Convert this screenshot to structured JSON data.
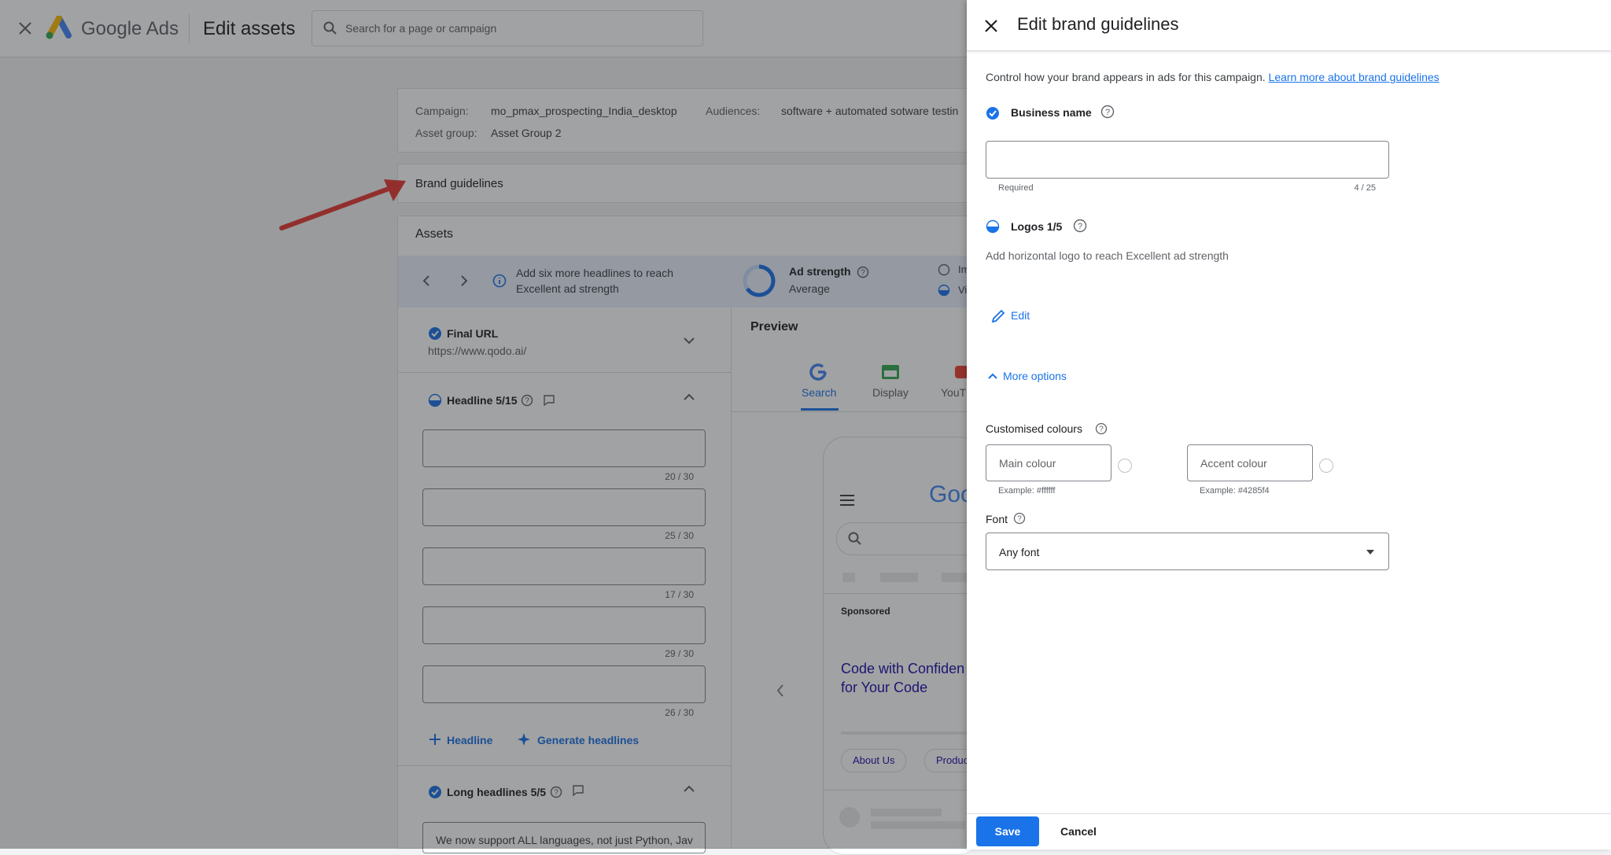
{
  "topbar": {
    "brand": "Google Ads",
    "page_title": "Edit assets",
    "search_placeholder": "Search for a page or campaign"
  },
  "summary": {
    "campaign_label": "Campaign:",
    "campaign_value": "mo_pmax_prospecting_India_desktop",
    "audiences_label": "Audiences:",
    "audiences_value": "software + automated sotware testin",
    "asset_group_label": "Asset group:",
    "asset_group_value": "Asset Group 2"
  },
  "brand_guidelines_row": "Brand guidelines",
  "assets": {
    "title": "Assets",
    "tip": [
      "Add six more headlines to reach",
      "Excellent ad strength"
    ],
    "ad_strength_label": "Ad strength",
    "ad_strength_value": "Average",
    "legend_partial": [
      "Im",
      "Vi"
    ],
    "final_url_label": "Final URL",
    "final_url_value": "https://www.qodo.ai/",
    "headline_section": "Headline 5/15",
    "headline_counts": [
      "20 / 30",
      "25 / 30",
      "17 / 30",
      "29 / 30",
      "26 / 30"
    ],
    "add_headline": "Headline",
    "generate_headlines": "Generate headlines",
    "long_headlines": "Long headlines 5/5",
    "long_headline_text": "We now support ALL languages, not just Python, Jav"
  },
  "preview": {
    "title": "Preview",
    "tabs": [
      "Search",
      "Display",
      "YouT"
    ],
    "phone_logo": "Goo",
    "sponsored": "Sponsored",
    "ad_headline": [
      "Code with Confiden",
      "for Your Code"
    ],
    "sitelinks": [
      "About Us",
      "Products"
    ]
  },
  "panel": {
    "title": "Edit brand guidelines",
    "intro": "Control how your brand appears in ads for this campaign.",
    "intro_link": "Learn more about brand guidelines",
    "business_name_label": "Business name",
    "business_name_value": "",
    "business_hint": "Required",
    "business_count": "4 / 25",
    "logos_label": "Logos 1/5",
    "logos_tip": "Add horizontal logo to reach Excellent ad strength",
    "edit_label": "Edit",
    "more_options": "More options",
    "colours_label": "Customised colours",
    "main_colour_placeholder": "Main colour",
    "main_colour_example": "Example: #ffffff",
    "accent_colour_placeholder": "Accent colour",
    "accent_colour_example": "Example: #4285f4",
    "font_label": "Font",
    "font_value": "Any font",
    "save": "Save",
    "cancel": "Cancel"
  },
  "colors": {
    "accent": "#1a73e8",
    "arrow": "#e53935"
  }
}
